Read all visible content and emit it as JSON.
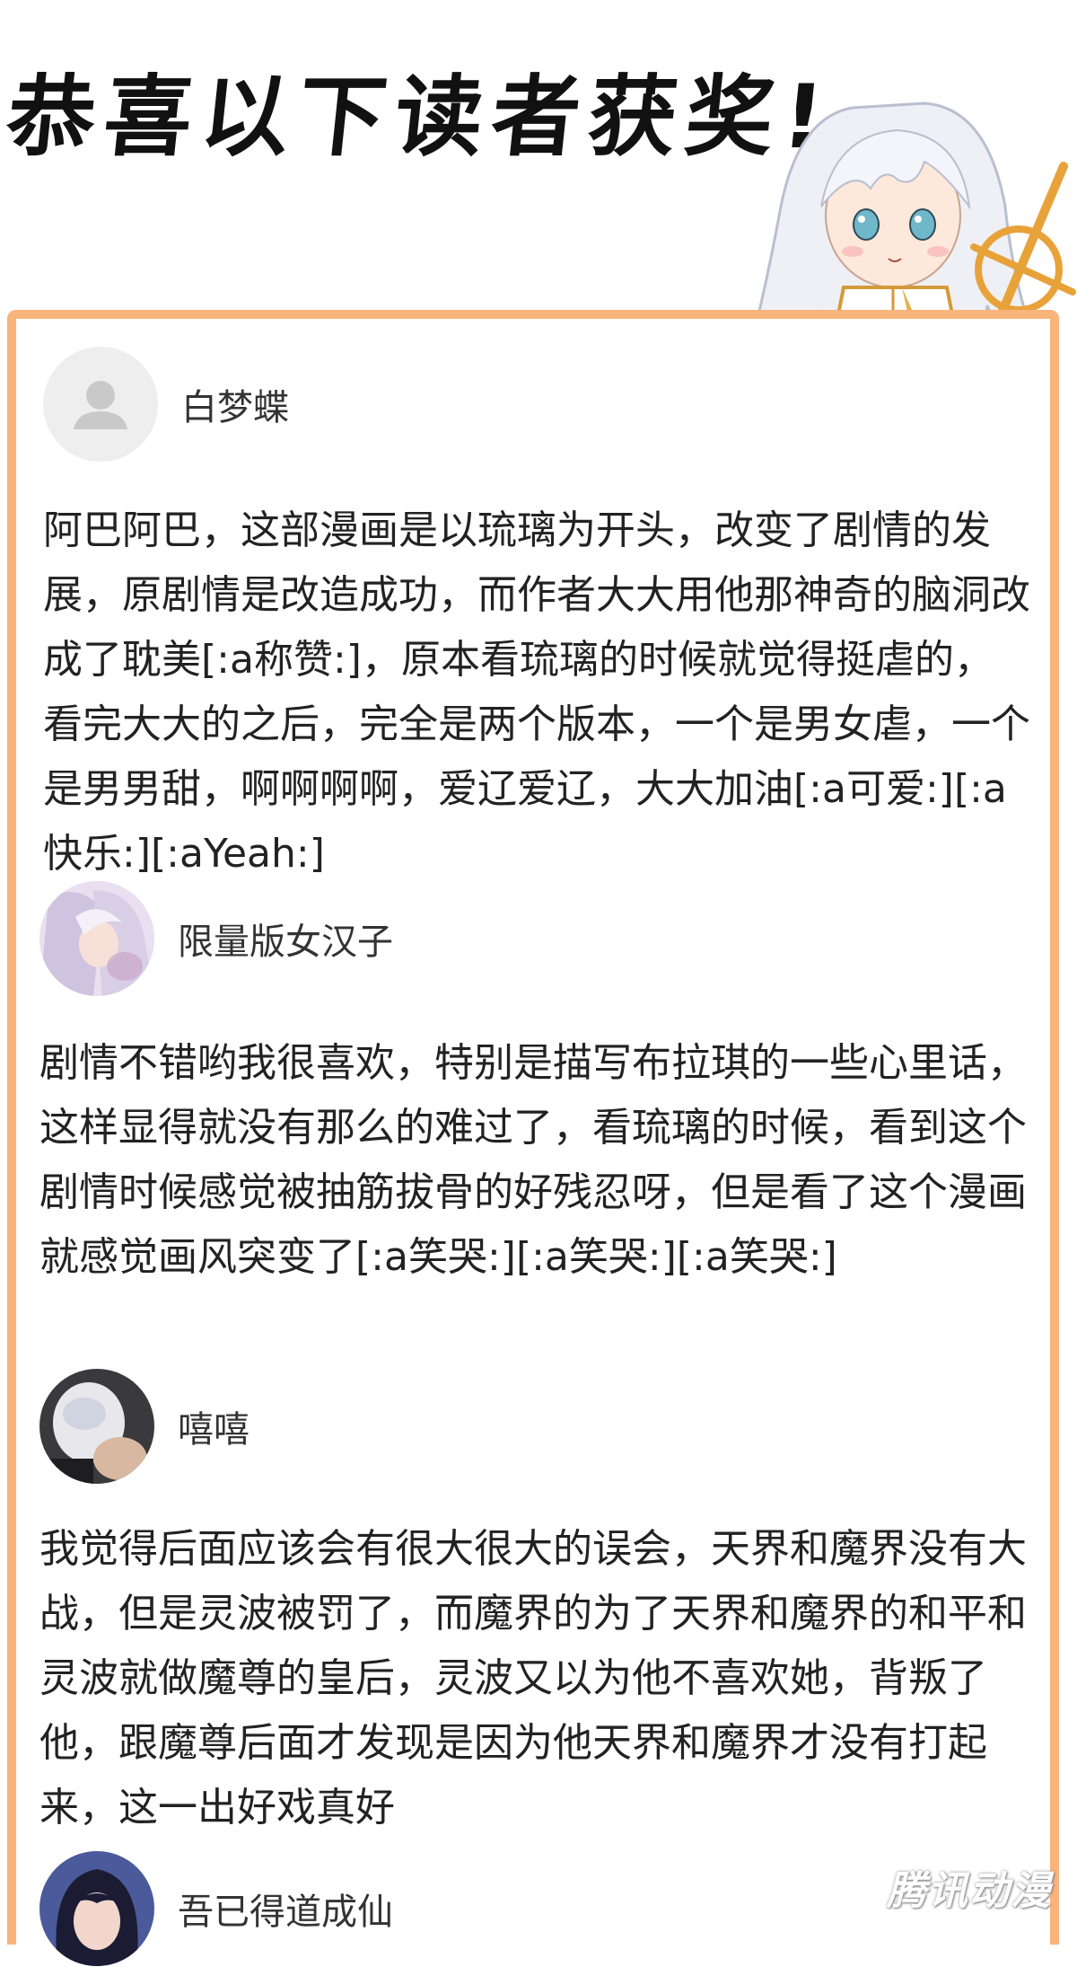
{
  "header": {
    "title": "恭喜以下读者获奖!"
  },
  "comments": [
    {
      "username": "白梦蝶",
      "avatar": "default-user-icon",
      "text": "阿巴阿巴，这部漫画是以琉璃为开头，改变了剧情的发展，原剧情是改造成功，而作者大大用他那神奇的脑洞改成了耽美[:a称赞:]，原本看琉璃的时候就觉得挺虐的，看完大大的之后，完全是两个版本，一个是男女虐，一个是男男甜，啊啊啊啊，爱辽爱辽，大大加油[:a可爱:][:a快乐:][:aYeah:]"
    },
    {
      "username": "限量版女汉子",
      "avatar": "anime-avatar",
      "text": "剧情不错哟我很喜欢，特别是描写布拉琪的一些心里话，这样显得就没有那么的难过了，看琉璃的时候，看到这个剧情时候感觉被抽筋拔骨的好残忍呀，但是看了这个漫画就感觉画风突变了[:a笑哭:][:a笑哭:][:a笑哭:]"
    },
    {
      "username": "嘻嘻",
      "avatar": "photo-avatar",
      "text": "我觉得后面应该会有很大很大的误会，天界和魔界没有大战，但是灵波被罚了，而魔界的为了天界和魔界的和平和灵波就做魔尊的皇后，灵波又以为他不喜欢她，背叛了他，跟魔尊后面才发现是因为他天界和魔界才没有打起来，这一出好戏真好"
    },
    {
      "username": "吾已得道成仙",
      "avatar": "anime-girl-avatar",
      "text": ""
    }
  ],
  "watermark": "腾讯动漫",
  "colors": {
    "card_border": "#f8b47b",
    "accent_gold": "#e8a23a"
  }
}
